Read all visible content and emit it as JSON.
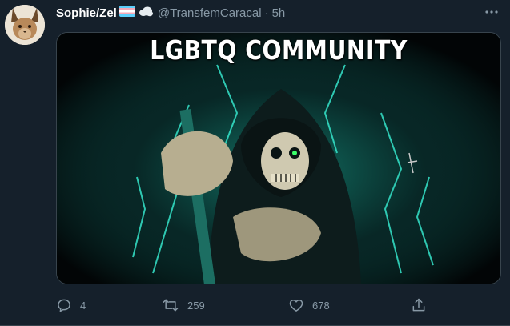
{
  "tweet": {
    "display_name": "Sophie/Zel",
    "name_emojis": [
      "transgender-flag-emoji",
      "cloud-emoji"
    ],
    "handle": "@TransfemCaracal",
    "separator": "·",
    "time": "5h",
    "media": {
      "title": "LGBTQ COMMUNITY",
      "description_icon": "grim-reaper-image"
    },
    "actions": {
      "reply_count": "4",
      "retweet_count": "259",
      "like_count": "678"
    }
  },
  "colors": {
    "background": "#15202b",
    "secondary_text": "#8899a6",
    "border": "#38444d",
    "accent_glow": "#2fe0c8"
  }
}
